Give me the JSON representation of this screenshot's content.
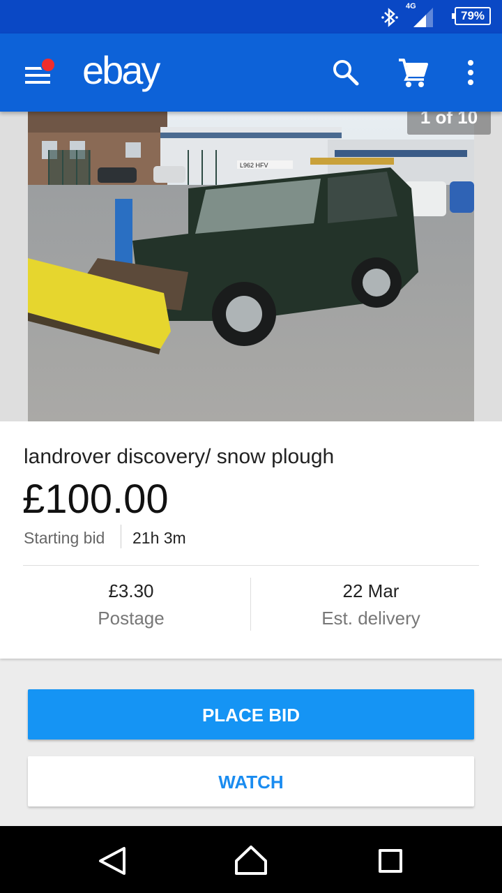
{
  "status_bar": {
    "network": "4G",
    "battery": "79%"
  },
  "app_bar": {
    "logo": "ebay",
    "accent": "#0d62d8"
  },
  "gallery": {
    "counter": "1 of 10",
    "plate_text": "L962 HFV"
  },
  "item": {
    "title": "landrover discovery/ snow plough",
    "price": "£100.00",
    "bid_type": "Starting bid",
    "time_left": "21h 3m",
    "postage_value": "£3.30",
    "postage_label": "Postage",
    "delivery_value": "22 Mar",
    "delivery_label": "Est. delivery"
  },
  "actions": {
    "place_bid": "PLACE BID",
    "watch": "WATCH",
    "place_bid_color": "#1594f4"
  },
  "icons": {
    "status": [
      "bluetooth-icon",
      "signal-icon",
      "battery-icon"
    ],
    "app_bar": [
      "menu-icon",
      "search-icon",
      "cart-icon",
      "more-vert-icon"
    ],
    "nav": [
      "back-icon",
      "home-icon",
      "recents-icon"
    ]
  }
}
